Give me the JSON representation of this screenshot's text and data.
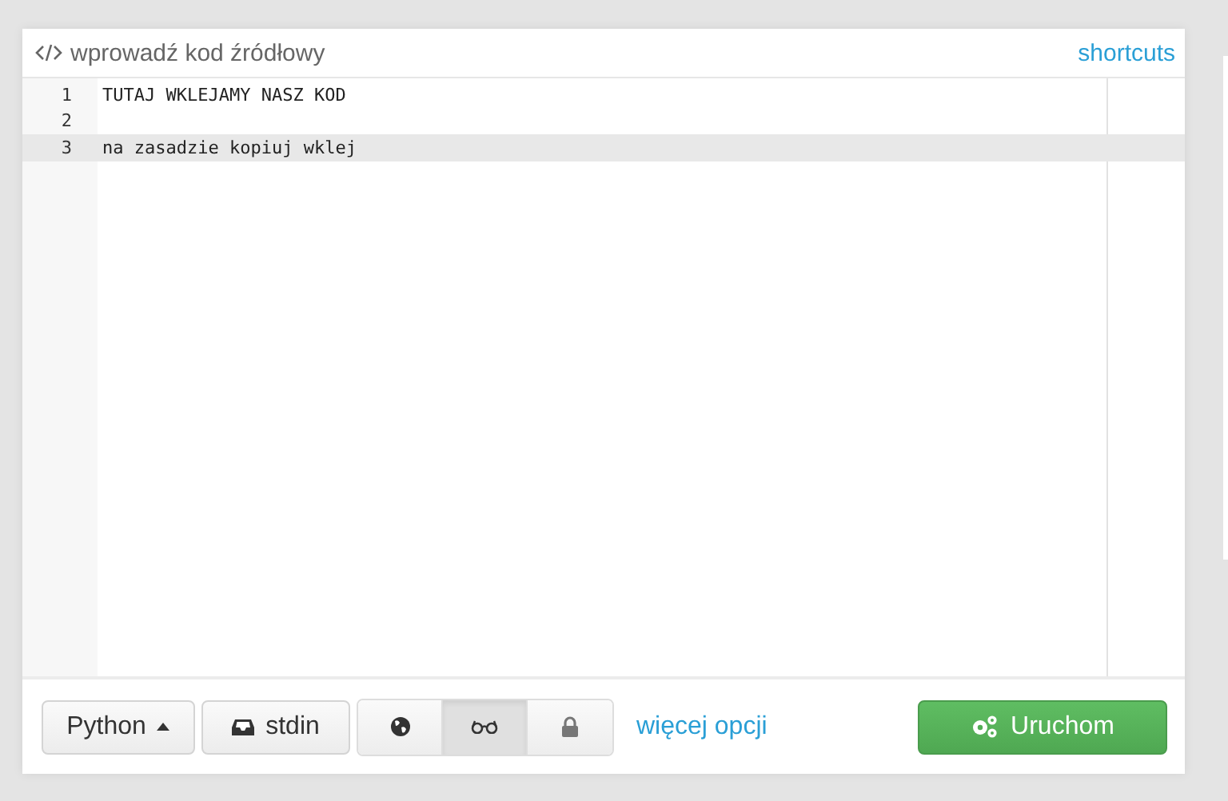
{
  "editor": {
    "title": "wprowadź kod źródłowy",
    "shortcuts_link": "shortcuts",
    "lines": [
      {
        "number": "1",
        "text": "TUTAJ WKLEJAMY NASZ KOD",
        "active": false
      },
      {
        "number": "2",
        "active": false
      },
      {
        "number": "3",
        "text": "na zasadzie kopiuj wklej",
        "active": true
      }
    ]
  },
  "toolbar": {
    "language": "Python",
    "stdin": "stdin",
    "toggles": [
      {
        "kind": "globe",
        "selected": false
      },
      {
        "kind": "glasses",
        "selected": true
      },
      {
        "kind": "lock",
        "selected": false
      }
    ],
    "more_link": "więcej opcji",
    "run_button": "Uruchom"
  }
}
